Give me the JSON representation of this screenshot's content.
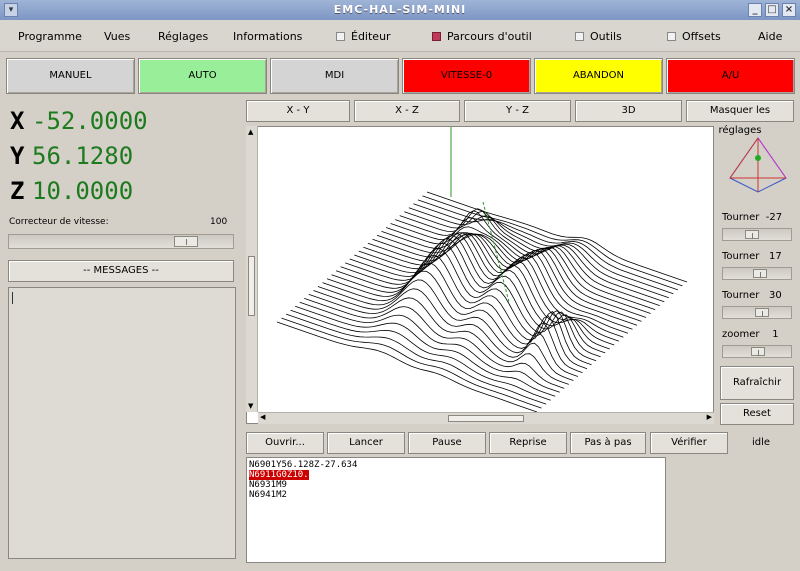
{
  "window": {
    "title": "EMC-HAL-SIM-MINI"
  },
  "menu": {
    "programme": "Programme",
    "vues": "Vues",
    "reglages": "Réglages",
    "informations": "Informations",
    "editeur": "Éditeur",
    "parcours": "Parcours d'outil",
    "outils": "Outils",
    "offsets": "Offsets",
    "aide": "Aide"
  },
  "modes": {
    "manuel": "MANUEL",
    "auto": "AUTO",
    "mdi": "MDI",
    "vitesse": "VITESSE-0",
    "abandon": "ABANDON",
    "au": "A/U",
    "colors": {
      "auto": "#99ee99",
      "vitesse": "#ff0000",
      "abandon": "#ffff00",
      "au": "#ff0000",
      "neutral": "#d4d4d4"
    }
  },
  "dro": {
    "x_axis": "X",
    "x_val": "-52.0000",
    "y_axis": "Y",
    "y_val": "56.1280",
    "z_axis": "Z",
    "z_val": "10.0000"
  },
  "feed_override": {
    "label": "Correcteur de vitesse:",
    "value": "100"
  },
  "messages": {
    "button": "-- MESSAGES --"
  },
  "view_tabs": {
    "xy": "X - Y",
    "xz": "X - Z",
    "yz": "Y - Z",
    "d3": "3D",
    "hide": "Masquer les réglages"
  },
  "view_controls": {
    "rot1_label": "Tourner",
    "rot1_val": "-27",
    "rot2_label": "Tourner",
    "rot2_val": "17",
    "rot3_label": "Tourner",
    "rot3_val": "30",
    "zoom_label": "zoomer",
    "zoom_val": "1",
    "refresh": "Rafraîchir",
    "reset": "Reset"
  },
  "actions": {
    "ouvrir": "Ouvrir...",
    "lancer": "Lancer",
    "pause": "Pause",
    "reprise": "Reprise",
    "pas": "Pas à pas",
    "verifier": "Vérifier"
  },
  "status": "idle",
  "gcode": [
    "N6901Y56.128Z-27.634",
    "N6911G0Z10.",
    "N6931M9",
    "N6941M2"
  ]
}
